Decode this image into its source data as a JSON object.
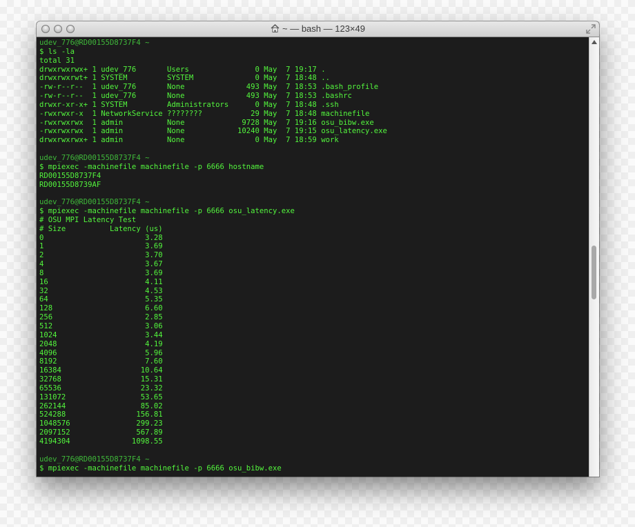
{
  "window": {
    "title": "~ — bash — 123×49",
    "icons": {
      "close": "close-button-icon",
      "minimize": "minimize-button-icon",
      "zoom": "zoom-button-icon",
      "home": "home-folder-icon",
      "resize": "fullscreen-icon"
    },
    "colors": {
      "terminal_bg": "#1c1c1c",
      "text": "#53f53d",
      "prompt": "#3fb83a"
    }
  },
  "terminal": {
    "lines": [
      "udev_776@RD00155D8737F4 ~",
      "$ ls -la",
      "total 31",
      "drwxrwxrwx+ 1 udev_776       Users               0 May  7 19:17 .",
      "drwxrwxrwt+ 1 SYSTEM         SYSTEM              0 May  7 18:48 ..",
      "-rw-r--r--  1 udev_776       None              493 May  7 18:53 .bash_profile",
      "-rw-r--r--  1 udev_776       None              493 May  7 18:53 .bashrc",
      "drwxr-xr-x+ 1 SYSTEM         Administrators      0 May  7 18:48 .ssh",
      "-rwxrwxr-x  1 NetworkService ????????           29 May  7 18:48 machinefile",
      "-rwxrwxrwx  1 admin          None             9728 May  7 19:16 osu_bibw.exe",
      "-rwxrwxrwx  1 admin          None            10240 May  7 19:15 osu_latency.exe",
      "drwxrwxrwx+ 1 admin          None                0 May  7 18:59 work",
      "",
      "udev_776@RD00155D8737F4 ~",
      "$ mpiexec -machinefile machinefile -p 6666 hostname",
      "RD00155D8737F4",
      "RD00155D8739AF",
      "",
      "udev_776@RD00155D8737F4 ~",
      "$ mpiexec -machinefile machinefile -p 6666 osu_latency.exe",
      "# OSU MPI Latency Test",
      "# Size          Latency (us)",
      "0                       3.28",
      "1                       3.69",
      "2                       3.70",
      "4                       3.67",
      "8                       3.69",
      "16                      4.11",
      "32                      4.53",
      "64                      5.35",
      "128                     6.60",
      "256                     2.85",
      "512                     3.06",
      "1024                    3.44",
      "2048                    4.19",
      "4096                    5.96",
      "8192                    7.60",
      "16384                  10.64",
      "32768                  15.31",
      "65536                  23.32",
      "131072                 53.65",
      "262144                 85.02",
      "524288                156.81",
      "1048576               299.23",
      "2097152               567.89",
      "4194304              1098.55",
      "",
      "udev_776@RD00155D8737F4 ~",
      "$ mpiexec -machinefile machinefile -p 6666 osu_bibw.exe"
    ]
  }
}
